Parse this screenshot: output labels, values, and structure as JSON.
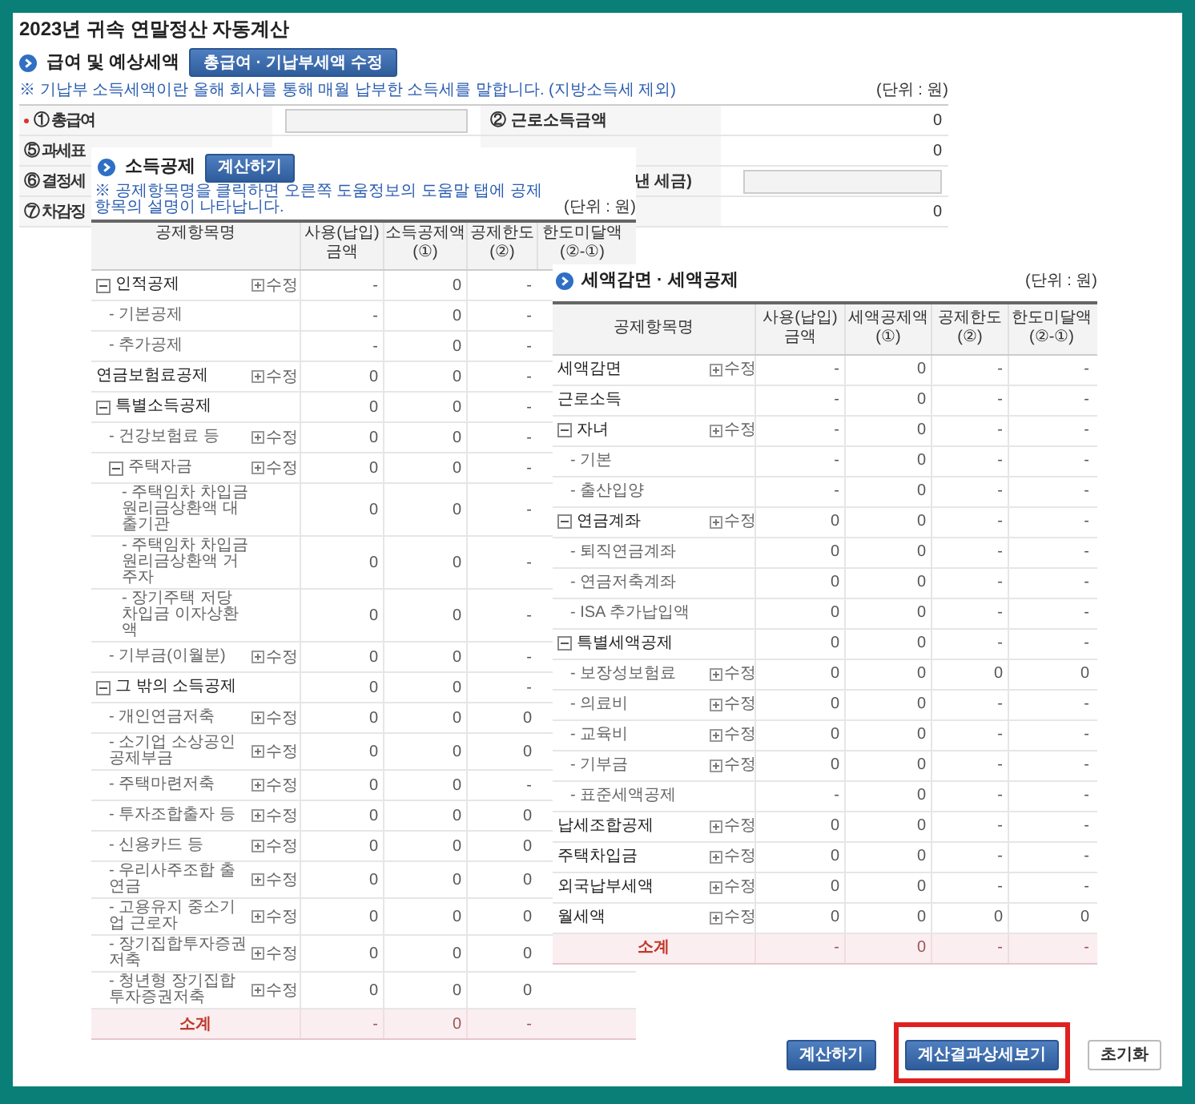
{
  "title": "2023년 귀속 연말정산 자동계산",
  "salary_section": {
    "heading": "급여 및 예상세액",
    "button": "총급여 · 기납부세액 수정",
    "note": "※ 기납부 소득세액이란 올해 회사를 통해 매월 납부한 소득세를 말합니다. (지방소득세 제외)",
    "unit": "(단위 : 원)",
    "rows": [
      {
        "label": "① 총급여",
        "required": true,
        "left_input": true,
        "right_label": "② 근로소득금액",
        "right_input": false,
        "right_value": "0"
      },
      {
        "label": "⑤ 과세표",
        "required": false,
        "left_input": false,
        "right_input": false,
        "right_value": "0"
      },
      {
        "label": "⑥ 결정세",
        "required": false,
        "left_input": false,
        "right_label": "낸 세금)",
        "right_input": true
      },
      {
        "label": "⑦ 차감징",
        "required": false,
        "left_input": false,
        "right_input": false,
        "right_value": "0"
      }
    ]
  },
  "income_deduction": {
    "heading": "소득공제",
    "button": "계산하기",
    "note": "※ 공제항목명을 클릭하면 오른쪽 도움정보의 도움말 탭에 공제항목의 설명이 나타납니다.",
    "unit": "(단위 : 원)",
    "columns": [
      "공제항목명",
      "사용(납입)\n금액",
      "소득공제액\n(①)",
      "공제한도\n(②)",
      "한도미달액\n(②-①)"
    ],
    "rows": [
      {
        "name": "인적공제",
        "expanded": true,
        "edit": "수정",
        "values": [
          "-",
          "0",
          "-"
        ],
        "children": [
          {
            "name": "- 기본공제",
            "values": [
              "-",
              "0",
              "-"
            ]
          },
          {
            "name": "- 추가공제",
            "values": [
              "-",
              "0",
              "-"
            ]
          }
        ]
      },
      {
        "name": "연금보험료공제",
        "edit": "수정",
        "values": [
          "0",
          "0",
          "-"
        ]
      },
      {
        "name": "특별소득공제",
        "expanded": true,
        "values": [
          "0",
          "0",
          "-"
        ],
        "children": [
          {
            "name": "- 건강보험료 등",
            "edit": "수정",
            "values": [
              "0",
              "0",
              "-"
            ]
          },
          {
            "name": "주택자금",
            "expanded": true,
            "edit": "수정",
            "values": [
              "0",
              "0",
              "-"
            ],
            "children": [
              {
                "name": "- 주택임차 차입금 원리금상환액 대출기관",
                "values": [
                  "0",
                  "0",
                  "-"
                ]
              },
              {
                "name": "- 주택임차 차입금 원리금상환액 거주자",
                "values": [
                  "0",
                  "0",
                  "-"
                ]
              },
              {
                "name": "- 장기주택 저당 차입금 이자상환액",
                "values": [
                  "0",
                  "0",
                  "-"
                ]
              }
            ]
          },
          {
            "name": "- 기부금(이월분)",
            "edit": "수정",
            "values": [
              "0",
              "0",
              "-"
            ]
          }
        ]
      },
      {
        "name": "그 밖의 소득공제",
        "expanded": true,
        "values": [
          "0",
          "0",
          "-"
        ],
        "children": [
          {
            "name": "- 개인연금저축",
            "edit": "수정",
            "values": [
              "0",
              "0",
              "0"
            ]
          },
          {
            "name": "- 소기업 소상공인 공제부금",
            "edit": "수정",
            "values": [
              "0",
              "0",
              "0"
            ]
          },
          {
            "name": "- 주택마련저축",
            "edit": "수정",
            "values": [
              "0",
              "0",
              "-"
            ]
          },
          {
            "name": "- 투자조합출자 등",
            "edit": "수정",
            "values": [
              "0",
              "0",
              "0"
            ]
          },
          {
            "name": "- 신용카드 등",
            "edit": "수정",
            "values": [
              "0",
              "0",
              "0"
            ]
          },
          {
            "name": "- 우리사주조합 출연금",
            "edit": "수정",
            "values": [
              "0",
              "0",
              "0"
            ]
          },
          {
            "name": "- 고용유지 중소기업 근로자",
            "edit": "수정",
            "values": [
              "0",
              "0",
              "0"
            ]
          },
          {
            "name": "- 장기집합투자증권저축",
            "edit": "수정",
            "values": [
              "0",
              "0",
              "0"
            ]
          },
          {
            "name": "- 청년형 장기집합투자증권저축",
            "edit": "수정",
            "values": [
              "0",
              "0",
              "0"
            ]
          }
        ]
      }
    ],
    "total": {
      "label": "소계",
      "values": [
        "-",
        "0",
        "-"
      ]
    }
  },
  "tax_credit": {
    "heading": "세액감면 · 세액공제",
    "unit": "(단위 : 원)",
    "columns": [
      "공제항목명",
      "사용(납입)\n금액",
      "세액공제액\n(①)",
      "공제한도\n(②)",
      "한도미달액\n(②-①)"
    ],
    "rows": [
      {
        "name": "세액감면",
        "edit": "수정",
        "values": [
          "-",
          "0",
          "-",
          "-"
        ]
      },
      {
        "name": "근로소득",
        "values": [
          "-",
          "0",
          "-",
          "-"
        ]
      },
      {
        "name": "자녀",
        "expanded": true,
        "edit": "수정",
        "values": [
          "-",
          "0",
          "-",
          "-"
        ],
        "children": [
          {
            "name": "- 기본",
            "values": [
              "-",
              "0",
              "-",
              "-"
            ]
          },
          {
            "name": "- 출산입양",
            "values": [
              "-",
              "0",
              "-",
              "-"
            ]
          }
        ]
      },
      {
        "name": "연금계좌",
        "expanded": true,
        "edit": "수정",
        "values": [
          "0",
          "0",
          "-",
          "-"
        ],
        "children": [
          {
            "name": "- 퇴직연금계좌",
            "values": [
              "0",
              "0",
              "-",
              "-"
            ]
          },
          {
            "name": "- 연금저축계좌",
            "values": [
              "0",
              "0",
              "-",
              "-"
            ]
          },
          {
            "name": "- ISA 추가납입액",
            "values": [
              "0",
              "0",
              "-",
              "-"
            ]
          }
        ]
      },
      {
        "name": "특별세액공제",
        "expanded": true,
        "values": [
          "0",
          "0",
          "-",
          "-"
        ],
        "children": [
          {
            "name": "- 보장성보험료",
            "edit": "수정",
            "values": [
              "0",
              "0",
              "0",
              "0"
            ]
          },
          {
            "name": "- 의료비",
            "edit": "수정",
            "values": [
              "0",
              "0",
              "-",
              "-"
            ]
          },
          {
            "name": "- 교육비",
            "edit": "수정",
            "values": [
              "0",
              "0",
              "-",
              "-"
            ]
          },
          {
            "name": "- 기부금",
            "edit": "수정",
            "values": [
              "0",
              "0",
              "-",
              "-"
            ]
          },
          {
            "name": "- 표준세액공제",
            "values": [
              "-",
              "0",
              "-",
              "-"
            ]
          }
        ]
      },
      {
        "name": "납세조합공제",
        "edit": "수정",
        "values": [
          "0",
          "0",
          "-",
          "-"
        ]
      },
      {
        "name": "주택차입금",
        "edit": "수정",
        "values": [
          "0",
          "0",
          "-",
          "-"
        ]
      },
      {
        "name": "외국납부세액",
        "edit": "수정",
        "values": [
          "0",
          "0",
          "-",
          "-"
        ]
      },
      {
        "name": "월세액",
        "edit": "수정",
        "values": [
          "0",
          "0",
          "0",
          "0"
        ]
      }
    ],
    "total": {
      "label": "소계",
      "values": [
        "-",
        "0",
        "-",
        "-"
      ]
    }
  },
  "buttons": [
    {
      "label": "계산하기",
      "kind": "primary",
      "highlighted": false
    },
    {
      "label": "계산결과상세보기",
      "kind": "primary",
      "highlighted": true
    },
    {
      "label": "초기화",
      "kind": "plain",
      "highlighted": false
    }
  ]
}
